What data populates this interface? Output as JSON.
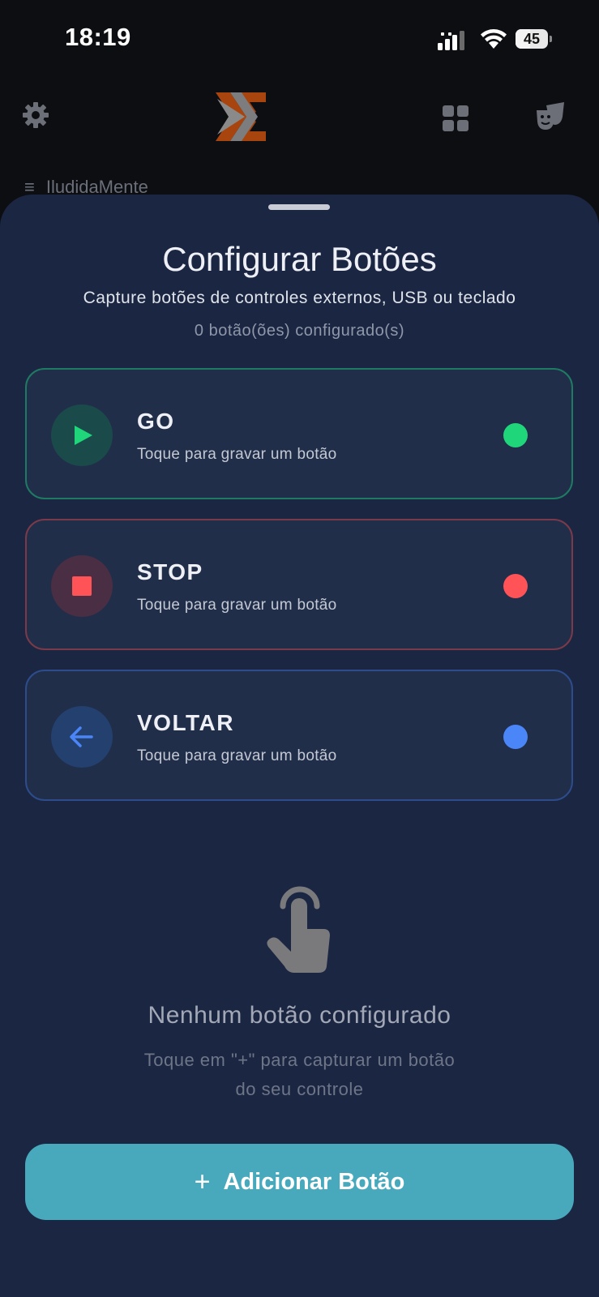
{
  "status_bar": {
    "time": "18:19",
    "battery": "45",
    "battery_level": 0.45
  },
  "header": {
    "icons": [
      "gear-icon",
      "app-logo",
      "grid-icon",
      "theater-masks-icon"
    ],
    "behind_title": "IludidaMente"
  },
  "sheet": {
    "title": "Configurar Botões",
    "subtitle": "Capture botões de controles externos, USB ou teclado",
    "count": "0 botão(ões) configurado(s)"
  },
  "cards": [
    {
      "label": "GO",
      "hint": "Toque para gravar um botão",
      "icon": "play-icon",
      "color": "#1fd67a"
    },
    {
      "label": "STOP",
      "hint": "Toque para gravar um botão",
      "icon": "stop-icon",
      "color": "#ff5358"
    },
    {
      "label": "VOLTAR",
      "hint": "Toque para gravar um botão",
      "icon": "arrow-left-icon",
      "color": "#4a86f7"
    }
  ],
  "empty_state": {
    "icon": "tap-hand-icon",
    "title": "Nenhum botão configurado",
    "description_line1": "Toque em \"+\" para capturar um botão",
    "description_line2": "do seu controle"
  },
  "add_button": {
    "plus": "+",
    "label": "Adicionar Botão",
    "color": "#48a9bd"
  }
}
